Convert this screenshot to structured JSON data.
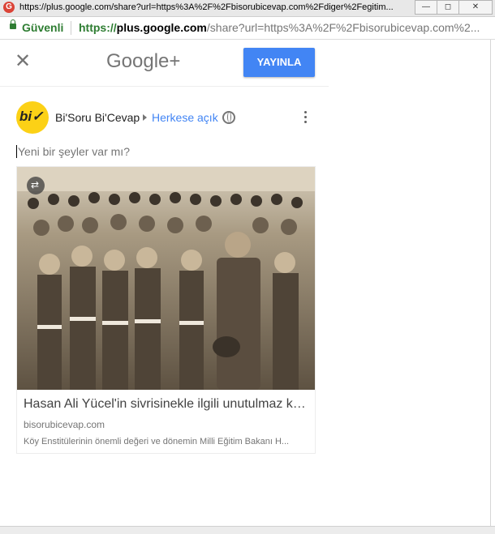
{
  "window": {
    "title": "https://plus.google.com/share?url=https%3A%2F%2Fbisorubicevap.com%2Fdiger%2Fegitim...",
    "min_symbol": "—",
    "max_symbol": "◻",
    "close_symbol": "✕"
  },
  "address_bar": {
    "secure_label": "Güvenli",
    "scheme": "https://",
    "host": "plus.google.com",
    "path": "/share?url=https%3A%2F%2Fbisorubicevap.com%2..."
  },
  "header": {
    "close_symbol": "✕",
    "logo": "Google+",
    "publish_label": "YAYINLA"
  },
  "post": {
    "avatar_text": "bi✓",
    "author": "Bi'Soru Bi'Cevap",
    "audience": "Herkese açık",
    "compose_placeholder": "Yeni bir şeyler var mı?"
  },
  "card": {
    "title": "Hasan Ali Yücel'in sivrisinekle ilgili unutulmaz kon...",
    "domain": "bisorubicevap.com",
    "description": "Köy Enstitülerinin önemli değeri ve dönemin Milli Eğitim Bakanı H..."
  },
  "colors": {
    "accent": "#4285f4",
    "secure_green": "#2e7d32",
    "avatar_yellow": "#fcd116",
    "photo_sepia": "#8a7e6b"
  },
  "icons": [
    "google-plus-favicon",
    "lock-icon",
    "close-icon",
    "chevron-right-icon",
    "globe-icon",
    "more-vert-icon",
    "reshare-icon"
  ]
}
